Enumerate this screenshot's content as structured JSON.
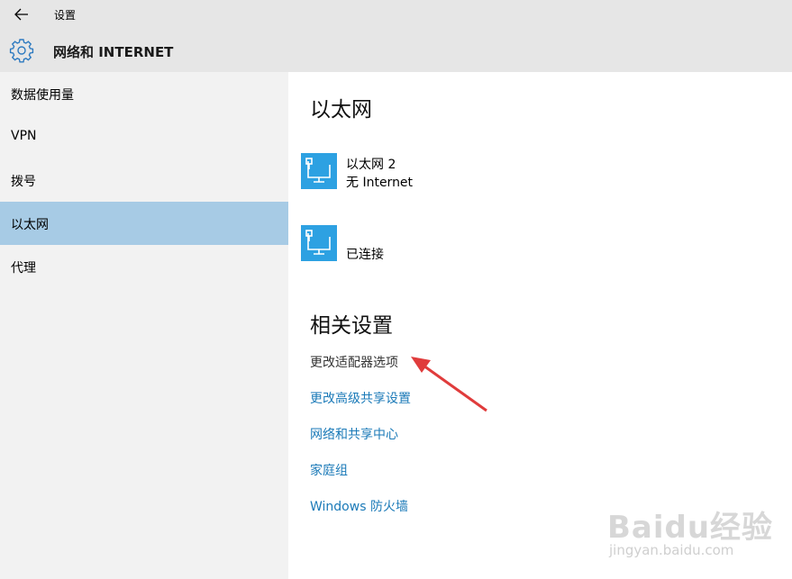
{
  "window": {
    "app_title": "设置"
  },
  "header": {
    "title": "网络和 INTERNET"
  },
  "sidebar": {
    "items": [
      {
        "label": "数据使用量"
      },
      {
        "label": "VPN"
      },
      {
        "label": "拨号"
      },
      {
        "label": "以太网",
        "selected": true
      },
      {
        "label": "代理"
      }
    ]
  },
  "main": {
    "heading": "以太网",
    "networks": [
      {
        "name": "以太网 2",
        "status": "无 Internet",
        "icon": "ethernet-monitor-icon"
      },
      {
        "name": "",
        "status": "已连接",
        "icon": "ethernet-monitor-icon"
      }
    ],
    "related_heading": "相关设置",
    "related_links": [
      "更改适配器选项",
      "更改高级共享设置",
      "网络和共享中心",
      "家庭组",
      "Windows 防火墙"
    ]
  },
  "watermark": {
    "logo": "Baidu经验",
    "url": "jingyan.baidu.com"
  },
  "colors": {
    "accent": "#2da1e2",
    "selected_nav": "#a7cbe5",
    "link": "#1b7ab8",
    "annotation_arrow": "#e03c3c"
  }
}
